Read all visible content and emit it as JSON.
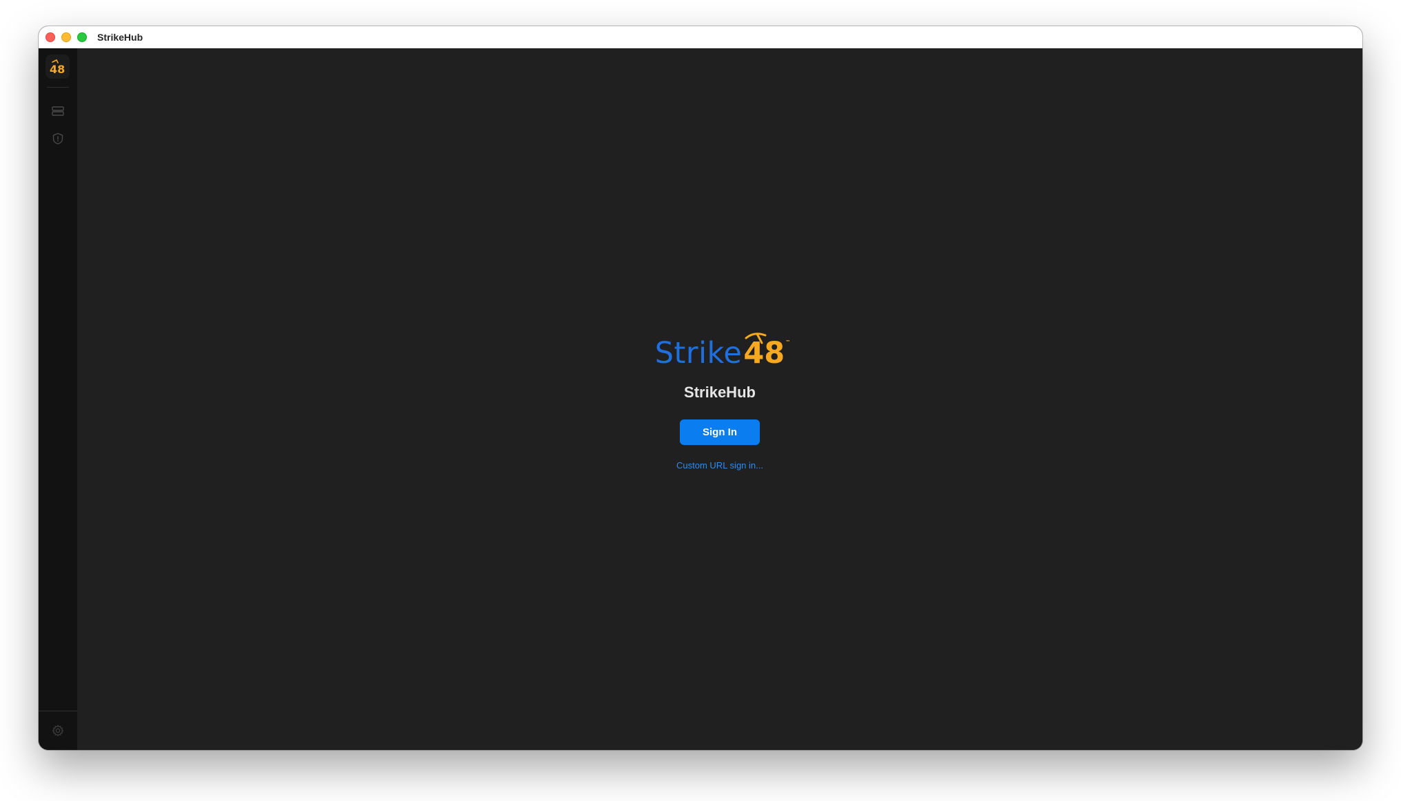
{
  "window": {
    "title": "StrikeHub"
  },
  "sidebar": {
    "logo_text": "48",
    "items": [
      {
        "icon": "server-icon"
      },
      {
        "icon": "shield-icon"
      }
    ],
    "footer_icon": "gear-icon"
  },
  "main": {
    "brand_word": "Strike",
    "brand_number": "48",
    "brand_tm": "™",
    "app_name": "StrikeHub",
    "sign_in_label": "Sign In",
    "custom_url_label": "Custom URL sign in..."
  },
  "colors": {
    "brand_blue": "#1f6fe0",
    "brand_orange": "#f6a821",
    "accent": "#0a7ef0",
    "background": "#202020",
    "sidebar": "#121212"
  }
}
